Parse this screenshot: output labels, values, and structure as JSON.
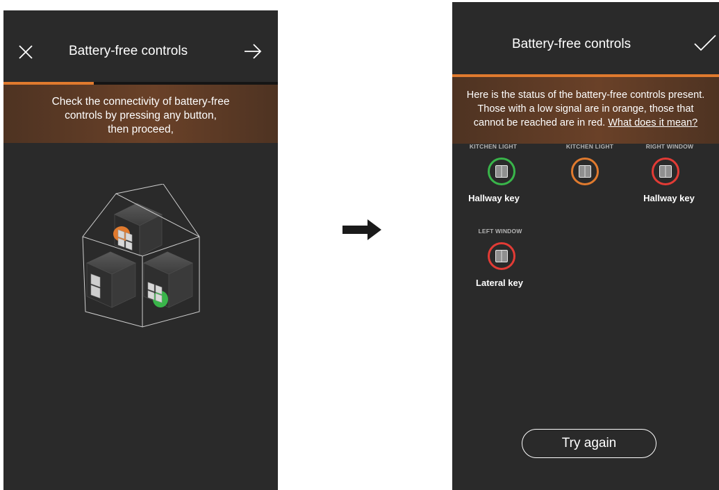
{
  "left_screen": {
    "header": {
      "title": "Battery-free controls",
      "close_icon": "close-icon",
      "next_icon": "arrow-right-icon"
    },
    "progress": 0.33,
    "banner_lines": [
      "Check the connectivity of battery-free",
      "controls by pressing any button,",
      "then proceed,"
    ],
    "illustration_icon": "house-with-switches-illustration"
  },
  "arrow_icon": "arrow-right-icon",
  "right_screen": {
    "header": {
      "title": "Battery-free controls",
      "confirm_icon": "checkmark-icon"
    },
    "progress": 1.0,
    "banner": {
      "line1": "Here is the status of the battery-free controls present.",
      "line2": "Those with a low signal are in orange, those that",
      "line3_text": "cannot be reached are in red.",
      "line3_link": "What does it mean?"
    },
    "controls": [
      {
        "label": "KITCHEN LIGHT",
        "name": "Hallway key",
        "status": "ok",
        "color": "#39b54a"
      },
      {
        "label": "KITCHEN LIGHT",
        "name": "",
        "status": "low-signal",
        "color": "#e07a2e"
      },
      {
        "label": "RIGHT WINDOW",
        "name": "Hallway key",
        "status": "unreachable",
        "color": "#e23b35"
      },
      {
        "label": "LEFT WINDOW",
        "name": "Lateral key",
        "status": "unreachable",
        "color": "#e23b35"
      }
    ],
    "try_again_label": "Try again"
  },
  "colors": {
    "screen_bg": "#2a2a2a",
    "accent": "#e07a2e",
    "ok": "#39b54a",
    "warn": "#e07a2e",
    "error": "#e23b35"
  }
}
